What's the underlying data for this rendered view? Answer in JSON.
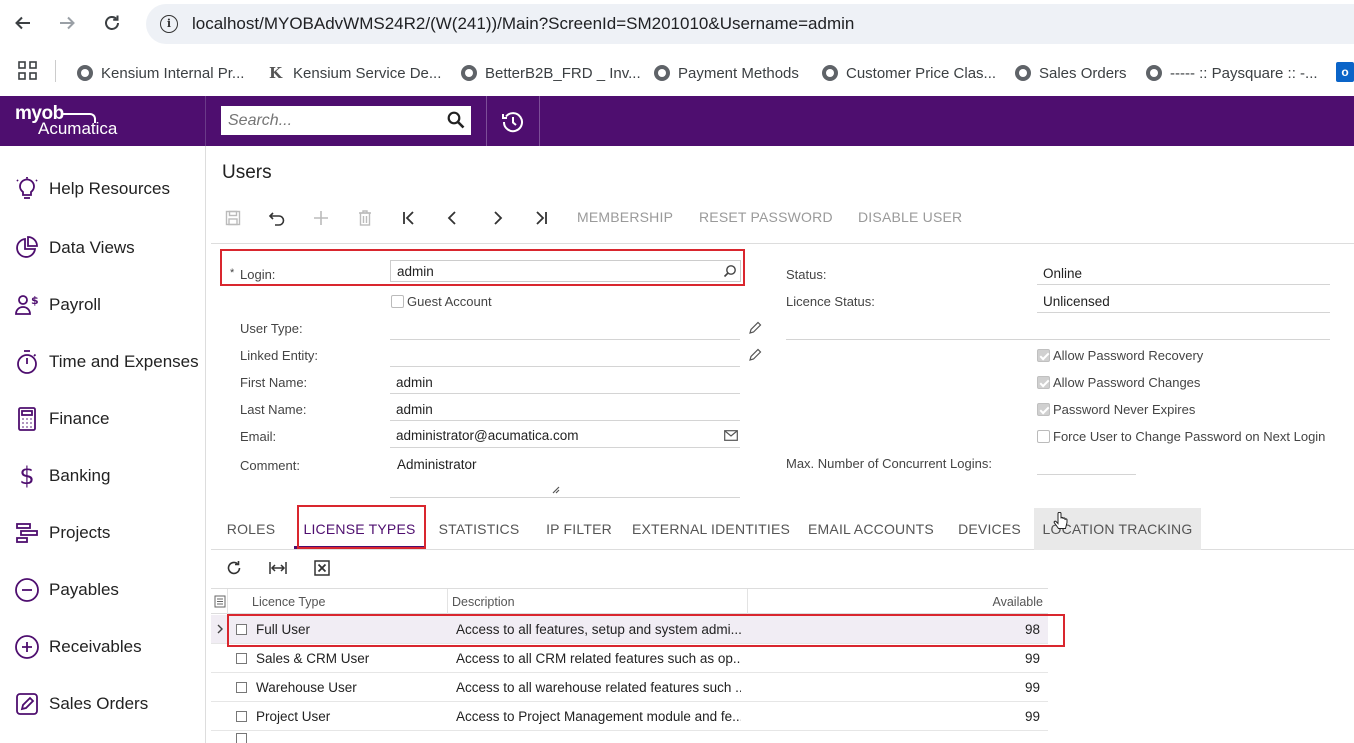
{
  "browser": {
    "url": "localhost/MYOBAdvWMS24R2/(W(241))/Main?ScreenId=SM201010&Username=admin",
    "bookmarks": [
      {
        "label": "Kensium Internal Pr...",
        "icon": "globe-icon"
      },
      {
        "label": "Kensium Service De...",
        "icon": "kensium-logo-icon"
      },
      {
        "label": "BetterB2B_FRD _ Inv...",
        "icon": "globe-icon"
      },
      {
        "label": "Payment Methods",
        "icon": "globe-icon"
      },
      {
        "label": "Customer Price Clas...",
        "icon": "globe-icon"
      },
      {
        "label": "Sales Orders",
        "icon": "globe-icon"
      },
      {
        "label": "----- :: Paysquare :: -...",
        "icon": "globe-icon"
      }
    ]
  },
  "header": {
    "logo_top": "myob",
    "logo_bottom": "Acumatica",
    "search_placeholder": "Search...",
    "brand_color": "#4e0e6f"
  },
  "sidebar": {
    "items": [
      {
        "label": "Help Resources",
        "icon": "lightbulb-icon"
      },
      {
        "label": "Data Views",
        "icon": "pie-chart-icon"
      },
      {
        "label": "Payroll",
        "icon": "people-dollar-icon"
      },
      {
        "label": "Time and Expenses",
        "icon": "stopwatch-icon"
      },
      {
        "label": "Finance",
        "icon": "calculator-icon"
      },
      {
        "label": "Banking",
        "icon": "dollar-icon"
      },
      {
        "label": "Projects",
        "icon": "gantt-icon"
      },
      {
        "label": "Payables",
        "icon": "minus-circle-icon"
      },
      {
        "label": "Receivables",
        "icon": "plus-circle-icon"
      },
      {
        "label": "Sales Orders",
        "icon": "pencil-square-icon"
      }
    ]
  },
  "page": {
    "title": "Users",
    "toolbar": {
      "membership": "MEMBERSHIP",
      "reset_password": "RESET PASSWORD",
      "disable_user": "DISABLE USER"
    }
  },
  "form": {
    "required_mark": "*",
    "login_label": "Login:",
    "login_value": "admin",
    "guest_account_label": "Guest Account",
    "guest_account_checked": false,
    "user_type_label": "User Type:",
    "user_type_value": "",
    "linked_entity_label": "Linked Entity:",
    "linked_entity_value": "",
    "first_name_label": "First Name:",
    "first_name_value": "admin",
    "last_name_label": "Last Name:",
    "last_name_value": "admin",
    "email_label": "Email:",
    "email_value": "administrator@acumatica.com",
    "comment_label": "Comment:",
    "comment_value": "Administrator",
    "status_label": "Status:",
    "status_value": "Online",
    "licence_status_label": "Licence Status:",
    "licence_status_value": "Unlicensed",
    "allow_password_recovery": "Allow Password Recovery",
    "allow_password_changes": "Allow Password Changes",
    "password_never_expires": "Password Never Expires",
    "force_change_password": "Force User to Change Password on Next Login",
    "max_logins_label": "Max. Number of Concurrent Logins:",
    "max_logins_value": ""
  },
  "tabs": [
    "ROLES",
    "LICENSE TYPES",
    "STATISTICS",
    "IP FILTER",
    "EXTERNAL IDENTITIES",
    "EMAIL ACCOUNTS",
    "DEVICES",
    "LOCATION TRACKING"
  ],
  "active_tab": "LICENSE TYPES",
  "grid": {
    "columns": [
      "Licence Type",
      "Description",
      "Available"
    ],
    "rows": [
      {
        "type": "Full User",
        "description": "Access to all features, setup and system admi...",
        "available": "98"
      },
      {
        "type": "Sales & CRM User",
        "description": "Access to all CRM related features such as op...",
        "available": "99"
      },
      {
        "type": "Warehouse User",
        "description": "Access to all warehouse related features such ...",
        "available": "99"
      },
      {
        "type": "Project User",
        "description": "Access to Project Management module and fe...",
        "available": "99"
      }
    ]
  }
}
